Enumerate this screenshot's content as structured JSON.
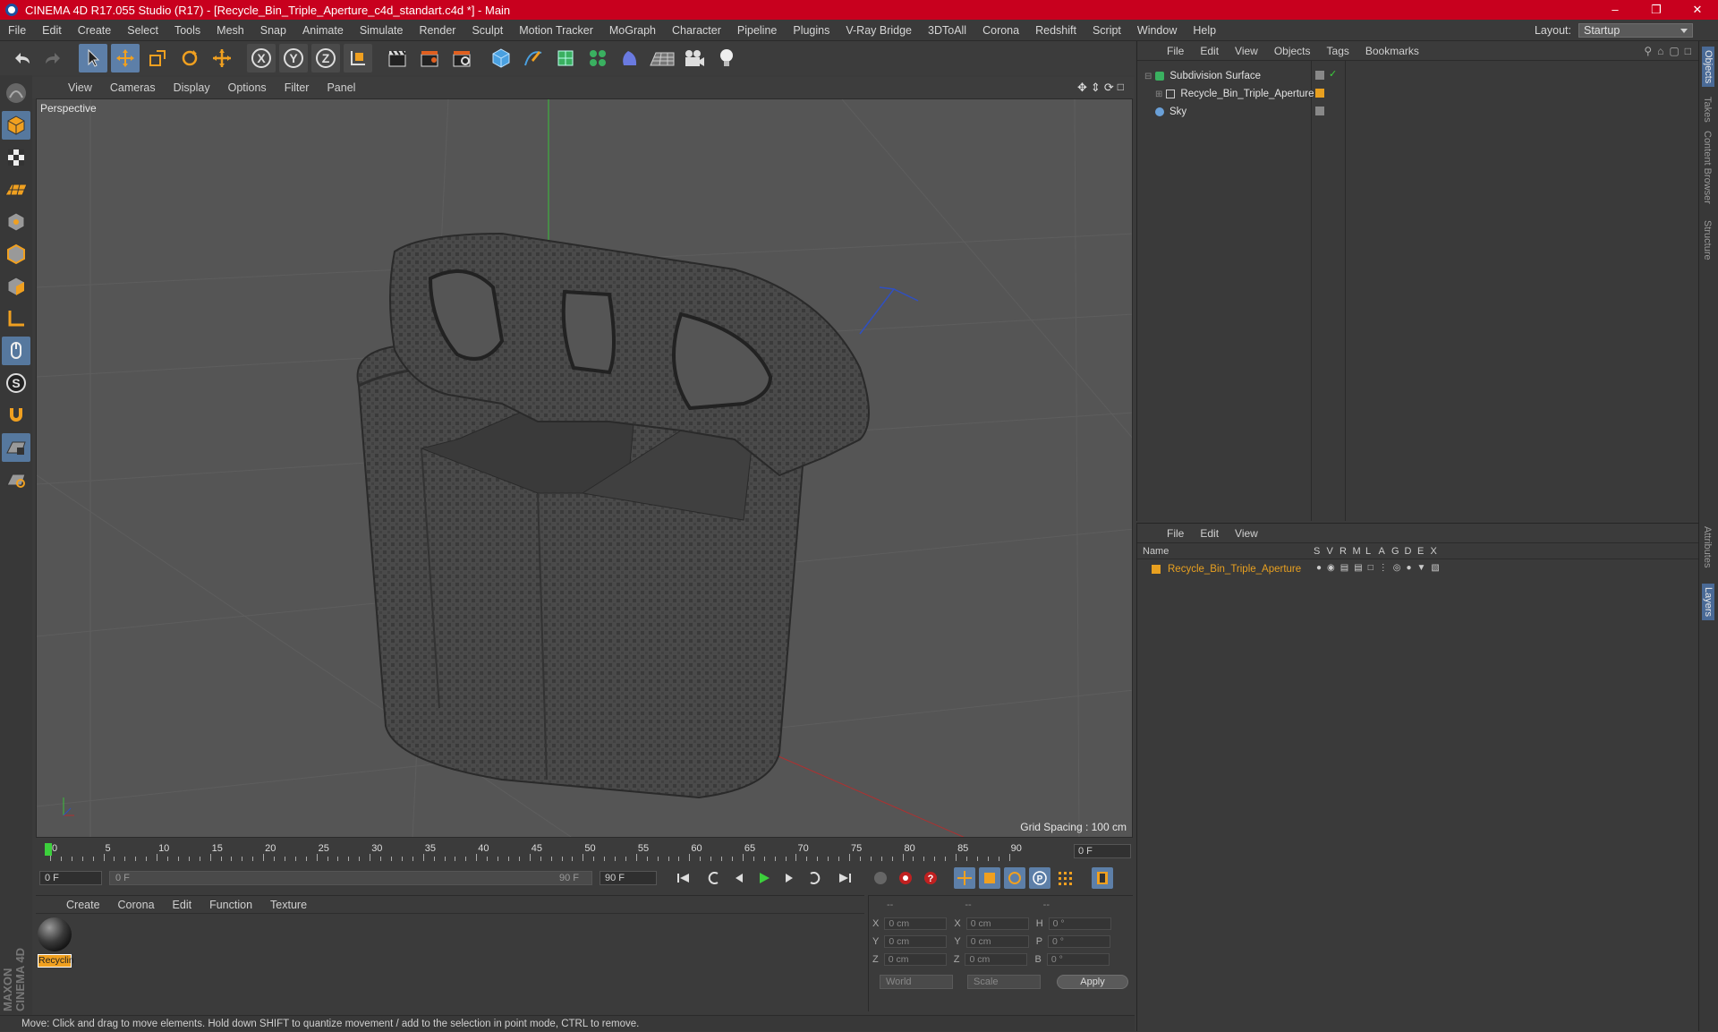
{
  "window": {
    "title": "CINEMA 4D R17.055 Studio (R17) - [Recycle_Bin_Triple_Aperture_c4d_standart.c4d *] - Main"
  },
  "menubar": [
    "File",
    "Edit",
    "Create",
    "Select",
    "Tools",
    "Mesh",
    "Snap",
    "Animate",
    "Simulate",
    "Render",
    "Sculpt",
    "Motion Tracker",
    "MoGraph",
    "Character",
    "Pipeline",
    "Plugins",
    "V-Ray Bridge",
    "3DToAll",
    "Corona",
    "Redshift",
    "Script",
    "Window",
    "Help"
  ],
  "layout": {
    "label": "Layout:",
    "value": "Startup"
  },
  "toolbar_icons": [
    "undo-icon",
    "redo-icon",
    "select-arrow-icon",
    "move-icon",
    "scale-icon",
    "rotate-icon",
    "live-select-icon",
    "x-axis-icon",
    "y-axis-icon",
    "z-axis-icon",
    "world-coords-icon",
    "render-view-icon",
    "render-picture-viewer-icon",
    "edit-render-settings-icon",
    "cube-icon",
    "pen-spline-icon",
    "subdivision-icon",
    "cloner-icon",
    "deformer-icon",
    "floor-icon",
    "camera-icon",
    "light-icon"
  ],
  "viewport": {
    "menu": [
      "View",
      "Cameras",
      "Display",
      "Options",
      "Filter",
      "Panel"
    ],
    "label": "Perspective",
    "grid_spacing": "Grid Spacing : 100 cm"
  },
  "timeline": {
    "ticks": [
      "0",
      "5",
      "10",
      "15",
      "20",
      "25",
      "30",
      "35",
      "40",
      "45",
      "50",
      "55",
      "60",
      "65",
      "70",
      "75",
      "80",
      "85",
      "90"
    ],
    "current_frame": "0 F"
  },
  "transport": {
    "start": "0 F",
    "slider_start": "0 F",
    "slider_end": "90 F",
    "end": "90 F"
  },
  "material_manager": {
    "menu": [
      "Create",
      "Corona",
      "Edit",
      "Function",
      "Texture"
    ],
    "materials": [
      {
        "name": "Recyclin"
      }
    ]
  },
  "coordinates": {
    "header": [
      "--",
      "--",
      "--"
    ],
    "rows": [
      {
        "a": "X",
        "av": "0 cm",
        "b": "X",
        "bv": "0 cm",
        "c": "H",
        "cv": "0 °"
      },
      {
        "a": "Y",
        "av": "0 cm",
        "b": "Y",
        "bv": "0 cm",
        "c": "P",
        "cv": "0 °"
      },
      {
        "a": "Z",
        "av": "0 cm",
        "b": "Z",
        "bv": "0 cm",
        "c": "B",
        "cv": "0 °"
      }
    ],
    "space": "World",
    "mode": "Scale",
    "apply": "Apply"
  },
  "object_manager": {
    "menu": [
      "File",
      "Edit",
      "View",
      "Objects",
      "Tags",
      "Bookmarks"
    ],
    "objects": [
      {
        "name": "Subdivision Surface"
      },
      {
        "name": "Recycle_Bin_Triple_Aperture"
      },
      {
        "name": "Sky"
      }
    ]
  },
  "layer_manager": {
    "menu": [
      "File",
      "Edit",
      "View"
    ],
    "columns": [
      "Name",
      "S",
      "V",
      "R",
      "M",
      "L",
      "A",
      "G",
      "D",
      "E",
      "X"
    ],
    "layers": [
      {
        "name": "Recycle_Bin_Triple_Aperture"
      }
    ]
  },
  "right_tabs": [
    "Objects",
    "Takes",
    "Content Browser",
    "Structure",
    "Attributes",
    "Layers"
  ],
  "status": "Move: Click and drag to move elements. Hold down SHIFT to quantize movement / add to the selection in point mode, CTRL to remove.",
  "brand": "MAXON CINEMA 4D",
  "colors": {
    "title_bar": "#c8001e",
    "accent_blue": "#5d7fa8",
    "layer_orange": "#e8a020"
  }
}
